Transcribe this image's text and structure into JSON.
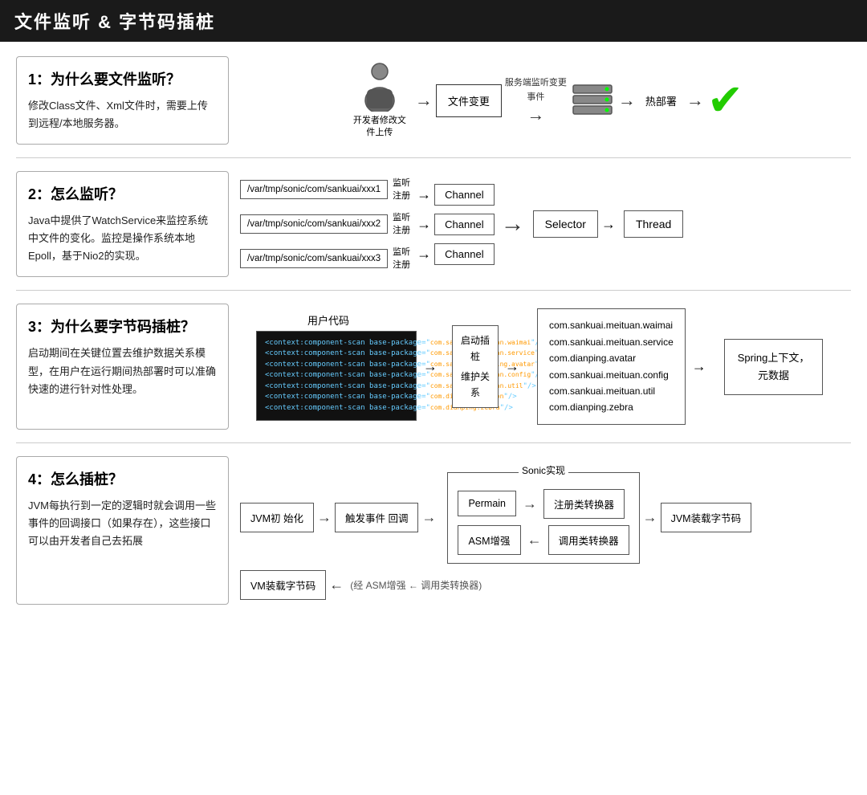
{
  "header": {
    "title": "文件监听 & 字节码插桩"
  },
  "section1": {
    "title": "1：为什么要文件监听？",
    "desc": "修改Class文件、Xml文件时，需要上传到远程/本地服务器。",
    "diagram": {
      "person_label": "开发者修改文\n件上传",
      "file_change": "文件变更",
      "server_label": "服务端监听变更\n事件",
      "hot_deploy": "热部署"
    }
  },
  "section2": {
    "title": "2：怎么监听？",
    "desc": "Java中提供了WatchService来监控系统中文件的变化。监控是操作系统本地Epoll，基于Nio2的实现。",
    "diagram": {
      "path1": "/var/tmp/sonic/com/sankuai/xxx1",
      "path2": "/var/tmp/sonic/com/sankuai/xxx2",
      "path3": "/var/tmp/sonic/com/sankuai/xxx3",
      "listen": "监听",
      "register": "注册",
      "channel": "Channel",
      "selector": "Selector",
      "thread": "Thread"
    }
  },
  "section3": {
    "title": "3：为什么要字节码插桩？",
    "desc": "启动期间在关键位置去维护数据关系模型，在用户在运行期间热部署时可以准确快速的进行针对性处理。",
    "diagram": {
      "user_code_label": "用户代码",
      "code_lines": [
        "<context:component-scan base-package=\"com.sankuai.meituan.waimai\"/>",
        "<context:component-scan base-package=\"com.sankuai.meituan.service\"/>",
        "<context:component-scan base-package=\"com.sankuai.dianping.avatar\"/>",
        "<context:component-scan base-package=\"com.sankuai.meituan.config\"/>",
        "<context:component-scan base-package=\"com.sankuai.meituan.util\"/>",
        "<context:component-scan base-package=\"com.dianping.common\"/>",
        "<context:component-scan base-package=\"com.dianping.zebra\"/>"
      ],
      "start_label1": "启动插",
      "start_label2": "桩",
      "maintain_label1": "维护关",
      "maintain_label2": "系",
      "packages": [
        "com.sankuai.meituan.waimai",
        "com.sankuai.meituan.service",
        "com.dianping.avatar",
        "com.sankuai.meituan.config",
        "com.sankuai.meituan.util",
        "com.dianping.zebra"
      ],
      "spring_label": "Spring上下文，\n元数据"
    }
  },
  "section4": {
    "title": "4：怎么插桩？",
    "desc": "JVM每执行到一定的逻辑时就会调用一些事件的回调接口（如果存在），这些接口可以由开发者自己去拓展",
    "diagram": {
      "jvm_init": "JVM初\n始化",
      "trigger": "触发事件\n回调",
      "sonic_label": "Sonic实现",
      "permain": "Permain",
      "register_converter": "注册类转换器",
      "jvm_load": "JVM装载字节码",
      "vm_load": "VM装载字节码",
      "asm": "ASM增强",
      "invoke_converter": "调用类转换器"
    }
  }
}
